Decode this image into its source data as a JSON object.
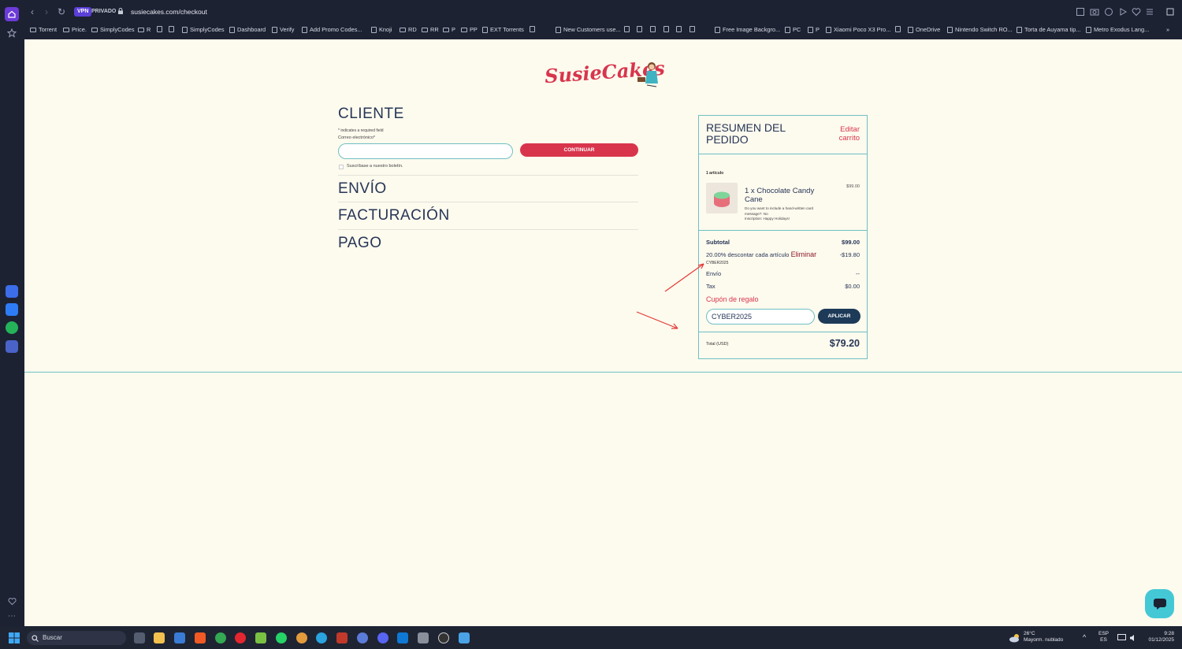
{
  "browser": {
    "vpn_label": "VPN",
    "private_label": "PRIVADO",
    "url": "susiecakes.com/checkout"
  },
  "bookmarks": [
    "Torrent",
    "Price.",
    "SimplyCodes",
    "R",
    "SimplyCodes",
    "Dashboard",
    "Verify",
    "Add Promo Codes...",
    "Knoji",
    "RD",
    "RR",
    "P",
    "PP",
    "EXT Torrents",
    "New Customers use...",
    "Free Image Backgro...",
    "PC",
    "P",
    "Xiaomi Poco X3 Pro...",
    "OneDrive",
    "Nintendo Switch RO...",
    "Torta de Auyama tip...",
    "Metro Exodus Lang..."
  ],
  "checkout": {
    "cliente_title": "CLIENTE",
    "required_note": "* indicates a required field",
    "email_label": "Correo electrónico*",
    "email_value": "",
    "continuar_label": "CONTINUAR",
    "newsletter_label": "Suscríbase a nuestro boletín.",
    "envio_title": "ENVÍO",
    "facturacion_title": "FACTURACIÓN",
    "pago_title": "PAGO"
  },
  "summary": {
    "title": "RESUMEN DEL PEDIDO",
    "edit_label": "Editar carrito",
    "item_count": "1 artículo",
    "product_name": "1 x Chocolate Candy Cane",
    "product_note": "Do you want to include a hand-written card message?: No",
    "product_inscription": "Inscription: Happy Holidays!",
    "product_price": "$99.00",
    "subtotal_label": "Subtotal",
    "subtotal_value": "$99.00",
    "discount_label": "20.00% descontar cada artículo",
    "discount_remove": "Eliminar",
    "discount_code": "CYBER2025",
    "discount_value": "-$19.80",
    "envio_label": "Envío",
    "envio_value": "--",
    "tax_label": "Tax",
    "tax_value": "$0.00",
    "gift_label": "Cupón de regalo",
    "coupon_value": "CYBER2025",
    "apply_label": "APLICAR",
    "total_label": "Total (USD)",
    "total_value": "$79.20"
  },
  "logo_text": "SusieCakes",
  "taskbar": {
    "search_label": "Buscar",
    "weather_temp": "26°C",
    "weather_desc": "Mayorm. nublado",
    "lang_1": "ESP",
    "lang_2": "ES",
    "time": "9:28",
    "date": "01/12/2025"
  },
  "colors": {
    "brand_red": "#d8354c",
    "navy": "#263656",
    "teal_border": "#6fc0c4",
    "page_bg": "#fdfaee"
  }
}
